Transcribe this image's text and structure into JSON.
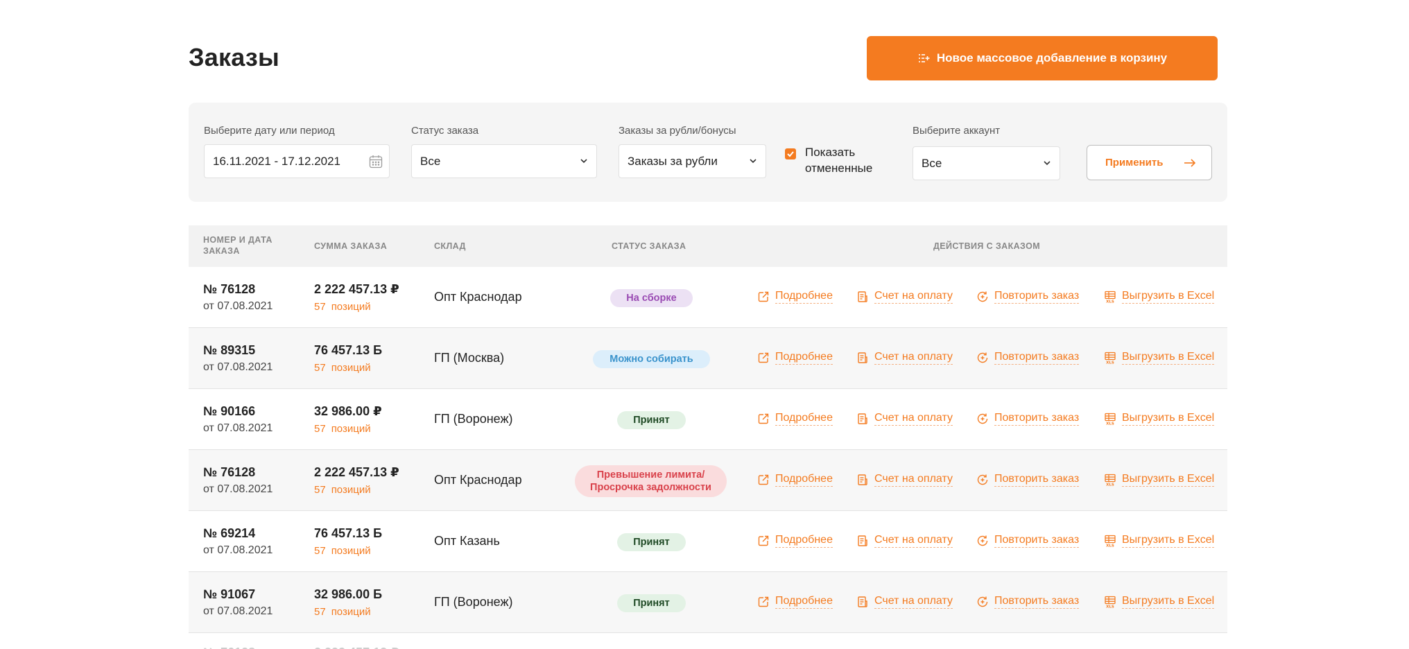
{
  "header": {
    "title": "Заказы",
    "bulk_button_label": "Новое массовое добавление в корзину"
  },
  "filters": {
    "date": {
      "label": "Выберите дату или период",
      "value": "16.11.2021 - 17.12.2021"
    },
    "status": {
      "label": "Статус заказа",
      "value": "Все"
    },
    "currency": {
      "label": "Заказы за рубли/бонусы",
      "value": "Заказы за рубли"
    },
    "show_cancelled": {
      "label": "Показать отмененные",
      "checked": true
    },
    "account": {
      "label": "Выберите аккаунт",
      "value": "Все"
    },
    "apply_label": "Применить"
  },
  "table": {
    "columns": {
      "number_date": "НОМЕР И ДАТА ЗАКАЗА",
      "sum": "СУММА ЗАКАЗА",
      "warehouse": "СКЛАД",
      "status": "СТАТУС ЗАКАЗА",
      "actions": "ДЕЙСТВИЯ С ЗАКАЗОМ"
    },
    "actions": {
      "details": "Подробнее",
      "invoice": "Счет на оплату",
      "repeat": "Повторить заказ",
      "excel": "Выгрузить в Excel"
    },
    "rows": [
      {
        "number": "№ 76128",
        "date": "от 07.08.2021",
        "amount": "2 222 457.13 ₽",
        "count": "57",
        "positions_word": "позиций",
        "warehouse": "Опт Краснодар",
        "status": "На сборке",
        "status_kind": "assembling"
      },
      {
        "number": "№ 89315",
        "date": "от 07.08.2021",
        "amount": "76 457.13 Б",
        "count": "57",
        "positions_word": "позиций",
        "warehouse": "ГП (Москва)",
        "status": "Можно собирать",
        "status_kind": "canassemble"
      },
      {
        "number": "№ 90166",
        "date": "от 07.08.2021",
        "amount": "32 986.00 ₽",
        "count": "57",
        "positions_word": "позиций",
        "warehouse": "ГП (Воронеж)",
        "status": "Принят",
        "status_kind": "accepted"
      },
      {
        "number": "№ 76128",
        "date": "от 07.08.2021",
        "amount": "2 222 457.13 ₽",
        "count": "57",
        "positions_word": "позиций",
        "warehouse": "Опт Краснодар",
        "status": "Превышение лимита/ Просрочка задолжности",
        "status_kind": "limit"
      },
      {
        "number": "№ 69214",
        "date": "от 07.08.2021",
        "amount": "76 457.13 Б",
        "count": "57",
        "positions_word": "позиций",
        "warehouse": "Опт Казань",
        "status": "Принят",
        "status_kind": "accepted"
      },
      {
        "number": "№ 91067",
        "date": "от 07.08.2021",
        "amount": "32 986.00 Б",
        "count": "57",
        "positions_word": "позиций",
        "warehouse": "ГП (Воронеж)",
        "status": "Принят",
        "status_kind": "accepted"
      }
    ]
  },
  "colors": {
    "accent": "#f47b20",
    "filter_bg": "#f5f5f5",
    "header_bg": "#f2f2f2"
  },
  "icons": {
    "bulk": "list-add-icon",
    "calendar": "calendar-icon",
    "dropdown": "chevron-down-icon",
    "apply": "arrow-right-icon",
    "details": "external-link-icon",
    "invoice": "document-icon",
    "repeat": "repeat-plus-icon",
    "excel": "xls-file-icon"
  }
}
